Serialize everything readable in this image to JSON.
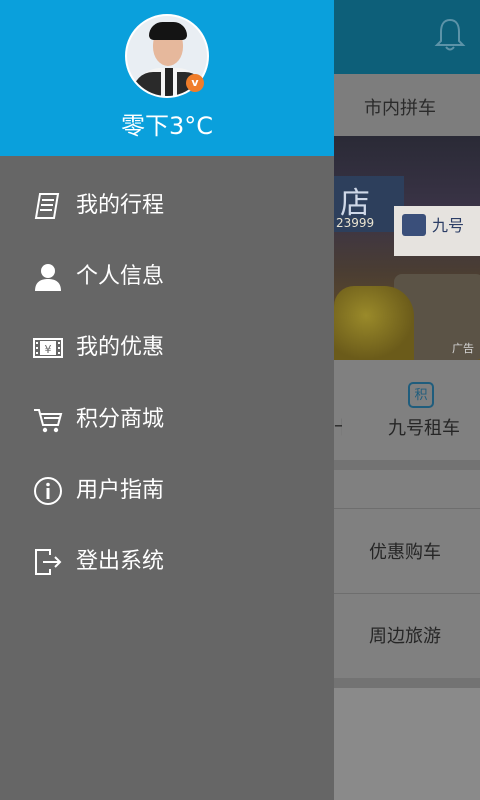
{
  "header": {
    "username": "零下3°C"
  },
  "menu": [
    {
      "label": "我的行程",
      "icon": "receipt-icon"
    },
    {
      "label": "个人信息",
      "icon": "person-icon"
    },
    {
      "label": "我的优惠",
      "icon": "coupon-icon"
    },
    {
      "label": "积分商城",
      "icon": "cart-icon"
    },
    {
      "label": "用户指南",
      "icon": "info-icon"
    },
    {
      "label": "登出系统",
      "icon": "logout-icon"
    }
  ],
  "background": {
    "tab_label": "市内拼车",
    "banner_ad_label": "广告",
    "banner_sign_char": "店",
    "banner_sign_number": "23999",
    "banner_sign2_text": "九号",
    "rent_icon_char": "积",
    "rent_label": "九号租车",
    "list": [
      "优惠购车",
      "周边旅游"
    ]
  },
  "colors": {
    "drawer_header": "#0aa0dc",
    "drawer_body": "#666666",
    "topbar": "#0d5f79"
  }
}
